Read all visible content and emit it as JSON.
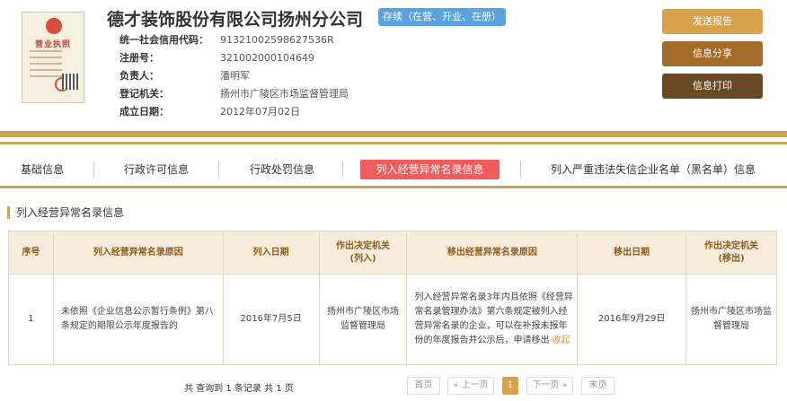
{
  "license_image": {
    "title": "营业执照"
  },
  "company": {
    "name": "德才装饰股份有限公司扬州分公司",
    "status": "存续（在营、开业、在册）"
  },
  "info": [
    {
      "label": "统一社会信用代码：",
      "value": "91321002598627536R"
    },
    {
      "label": "注册号：",
      "value": "321002000104649"
    },
    {
      "label": "负责人：",
      "value": "潘明军"
    },
    {
      "label": "登记机关：",
      "value": "扬州市广陵区市场监督管理局"
    },
    {
      "label": "成立日期：",
      "value": "2012年07月02日"
    }
  ],
  "actions": {
    "send_report": "发送报告",
    "share": "信息分享",
    "print": "信息打印"
  },
  "tabs": [
    {
      "label": "基础信息",
      "active": false
    },
    {
      "label": "行政许可信息",
      "active": false
    },
    {
      "label": "行政处罚信息",
      "active": false
    },
    {
      "label": "列入经营异常名录信息",
      "active": true
    },
    {
      "label": "列入严重违法失信企业名单（黑名单）信息",
      "active": false
    }
  ],
  "section": {
    "title": "列入经营异常名录信息"
  },
  "table": {
    "headers": [
      "序号",
      "列入经营异常名录原因",
      "列入日期",
      "作出决定机关\n(列入)",
      "移出经营异常名录原因",
      "移出日期",
      "作出决定机关\n(移出)"
    ],
    "rows": [
      {
        "index": "1",
        "reason_in": "未依照《企业信息公示暂行条例》第八条规定的期限公示年度报告的",
        "date_in": "2016年7月5日",
        "authority_in": "扬州市广陵区市场监督管理局",
        "reason_out": "列入经营异常名录3年内且依照《经营异常名录管理办法》第六条规定被列入经营异常名录的企业，可以在补报未报年份的年度报告并公示后，申请移出",
        "collapse": "收起",
        "date_out": "2016年9月29日",
        "authority_out": "扬州市广陵区市场监督管理局"
      }
    ]
  },
  "pagination": {
    "summary": "共 查询到 1 条记录 共 1 页",
    "first": "首页",
    "prev": "« 上一页",
    "current": "1",
    "next": "下一页 »",
    "last": "末页"
  },
  "colors": {
    "gold": "#c8a55a",
    "active_tab": "#f25b5b",
    "status": "#58a3e0"
  }
}
